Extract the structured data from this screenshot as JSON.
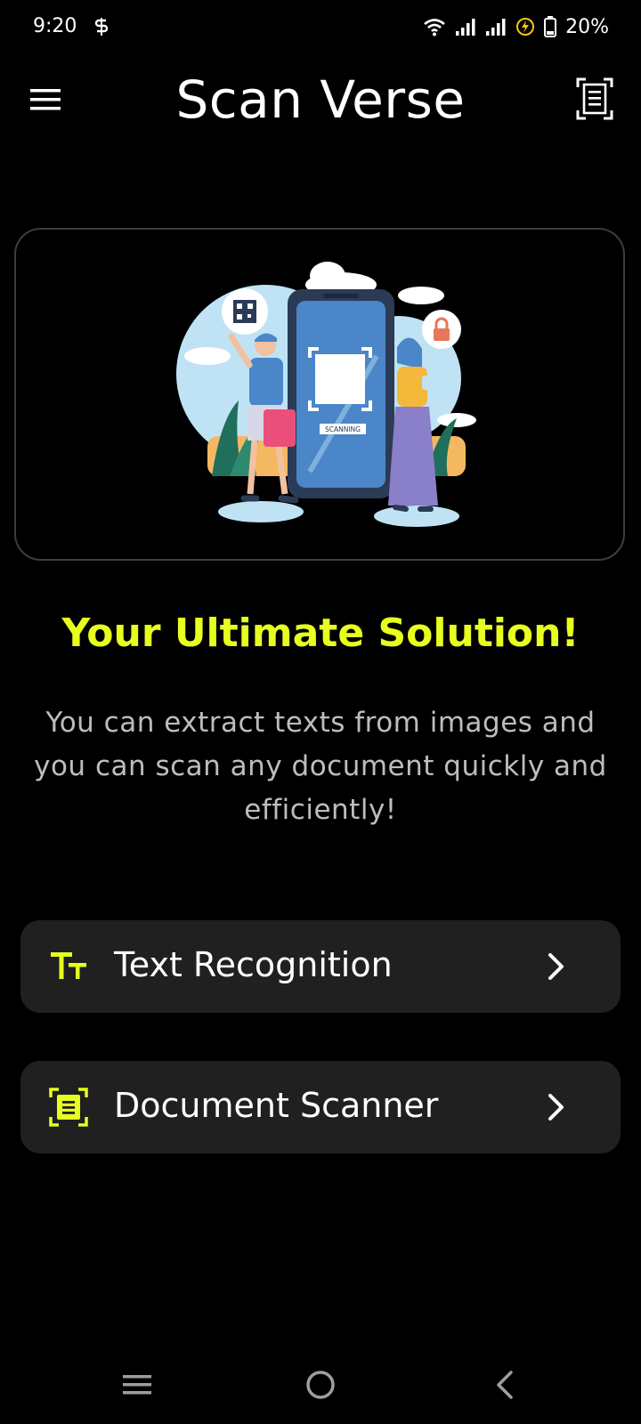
{
  "status_bar": {
    "time": "9:20",
    "battery_percent": "20%",
    "icons": [
      "s-sync-icon",
      "wifi-icon",
      "signal-icon",
      "signal-icon",
      "charging-icon",
      "battery-icon"
    ]
  },
  "app_bar": {
    "title": "Scan Verse",
    "menu_icon": "hamburger-menu-icon",
    "action_icon": "document-scan-icon"
  },
  "hero": {
    "illustration": "scanning-phone-illustration",
    "illustration_label": "SCANNING"
  },
  "headline": "Your Ultimate Solution!",
  "description": "You can extract texts from images and you can scan any document quickly and efficiently!",
  "actions": [
    {
      "label": "Text Recognition",
      "icon": "text-size-icon"
    },
    {
      "label": "Document Scanner",
      "icon": "document-scan-icon"
    }
  ],
  "nav_bar": {
    "items": [
      "recents-icon",
      "home-icon",
      "back-icon"
    ]
  },
  "colors": {
    "accent": "#e6ff1f",
    "background": "#000000",
    "card": "#202020",
    "text_secondary": "#bdbdbd"
  }
}
